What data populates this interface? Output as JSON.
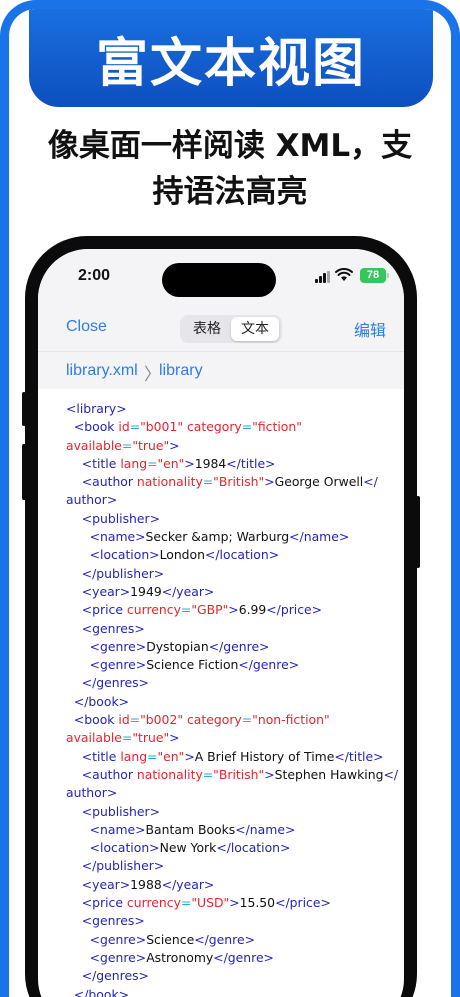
{
  "banner": {
    "title": "富文本视图"
  },
  "subtitle": {
    "line1": "像桌面一样阅读 XML，支",
    "line2": "持语法高亮"
  },
  "status": {
    "time": "2:00",
    "battery": "78"
  },
  "toolbar": {
    "close_label": "Close",
    "tab_table": "表格",
    "tab_text": "文本",
    "edit_label": "编辑"
  },
  "breadcrumb": {
    "file": "library.xml",
    "separator": "〉",
    "node": "library"
  },
  "icons": {
    "signal": "cellular-signal-icon",
    "wifi": "wifi-icon",
    "battery": "battery-icon"
  },
  "colors": {
    "accent": "#1a73e8",
    "tag": "#2424b8",
    "attr": "#e8232e",
    "battery": "#34c759"
  },
  "xml_lines": [
    [
      [
        "t",
        "<library>"
      ]
    ],
    [
      [
        "t",
        "  <book "
      ],
      [
        "a",
        "id"
      ],
      [
        "e",
        "="
      ],
      [
        "v",
        "\"b001\""
      ],
      [
        "t",
        " "
      ],
      [
        "a",
        "category"
      ],
      [
        "e",
        "="
      ],
      [
        "v",
        "\"fiction\""
      ]
    ],
    [
      [
        "a",
        "available"
      ],
      [
        "e",
        "="
      ],
      [
        "v",
        "\"true\""
      ],
      [
        "t",
        ">"
      ]
    ],
    [
      [
        "t",
        "    <title "
      ],
      [
        "a",
        "lang"
      ],
      [
        "e",
        "="
      ],
      [
        "v",
        "\"en\""
      ],
      [
        "t",
        ">"
      ],
      [
        "x",
        "1984"
      ],
      [
        "t",
        "</title>"
      ]
    ],
    [
      [
        "t",
        "    <author "
      ],
      [
        "a",
        "nationality"
      ],
      [
        "e",
        "="
      ],
      [
        "v",
        "\"British\""
      ],
      [
        "t",
        ">"
      ],
      [
        "x",
        "George Orwell"
      ],
      [
        "t",
        "</"
      ]
    ],
    [
      [
        "t",
        "author>"
      ]
    ],
    [
      [
        "t",
        "    <publisher>"
      ]
    ],
    [
      [
        "t",
        "      <name>"
      ],
      [
        "x",
        "Secker "
      ],
      [
        "n",
        "&amp;"
      ],
      [
        "x",
        " Warburg"
      ],
      [
        "t",
        "</name>"
      ]
    ],
    [
      [
        "t",
        "      <location>"
      ],
      [
        "x",
        "London"
      ],
      [
        "t",
        "</location>"
      ]
    ],
    [
      [
        "t",
        "    </publisher>"
      ]
    ],
    [
      [
        "t",
        "    <year>"
      ],
      [
        "x",
        "1949"
      ],
      [
        "t",
        "</year>"
      ]
    ],
    [
      [
        "t",
        "    <price "
      ],
      [
        "a",
        "currency"
      ],
      [
        "e",
        "="
      ],
      [
        "v",
        "\"GBP\""
      ],
      [
        "t",
        ">"
      ],
      [
        "x",
        "6.99"
      ],
      [
        "t",
        "</price>"
      ]
    ],
    [
      [
        "t",
        "    <genres>"
      ]
    ],
    [
      [
        "t",
        "      <genre>"
      ],
      [
        "x",
        "Dystopian"
      ],
      [
        "t",
        "</genre>"
      ]
    ],
    [
      [
        "t",
        "      <genre>"
      ],
      [
        "x",
        "Science Fiction"
      ],
      [
        "t",
        "</genre>"
      ]
    ],
    [
      [
        "t",
        "    </genres>"
      ]
    ],
    [
      [
        "t",
        "  </book>"
      ]
    ],
    [
      [
        "t",
        "  <book "
      ],
      [
        "a",
        "id"
      ],
      [
        "e",
        "="
      ],
      [
        "v",
        "\"b002\""
      ],
      [
        "t",
        " "
      ],
      [
        "a",
        "category"
      ],
      [
        "e",
        "="
      ],
      [
        "v",
        "\"non-fiction\""
      ]
    ],
    [
      [
        "a",
        "available"
      ],
      [
        "e",
        "="
      ],
      [
        "v",
        "\"true\""
      ],
      [
        "t",
        ">"
      ]
    ],
    [
      [
        "t",
        "    <title "
      ],
      [
        "a",
        "lang"
      ],
      [
        "e",
        "="
      ],
      [
        "v",
        "\"en\""
      ],
      [
        "t",
        ">"
      ],
      [
        "x",
        "A Brief History of Time"
      ],
      [
        "t",
        "</title>"
      ]
    ],
    [
      [
        "t",
        "    <author "
      ],
      [
        "a",
        "nationality"
      ],
      [
        "e",
        "="
      ],
      [
        "v",
        "\"British\""
      ],
      [
        "t",
        ">"
      ],
      [
        "x",
        "Stephen Hawking"
      ],
      [
        "t",
        "</"
      ]
    ],
    [
      [
        "t",
        "author>"
      ]
    ],
    [
      [
        "t",
        "    <publisher>"
      ]
    ],
    [
      [
        "t",
        "      <name>"
      ],
      [
        "x",
        "Bantam Books"
      ],
      [
        "t",
        "</name>"
      ]
    ],
    [
      [
        "t",
        "      <location>"
      ],
      [
        "x",
        "New York"
      ],
      [
        "t",
        "</location>"
      ]
    ],
    [
      [
        "t",
        "    </publisher>"
      ]
    ],
    [
      [
        "t",
        "    <year>"
      ],
      [
        "x",
        "1988"
      ],
      [
        "t",
        "</year>"
      ]
    ],
    [
      [
        "t",
        "    <price "
      ],
      [
        "a",
        "currency"
      ],
      [
        "e",
        "="
      ],
      [
        "v",
        "\"USD\""
      ],
      [
        "t",
        ">"
      ],
      [
        "x",
        "15.50"
      ],
      [
        "t",
        "</price>"
      ]
    ],
    [
      [
        "t",
        "    <genres>"
      ]
    ],
    [
      [
        "t",
        "      <genre>"
      ],
      [
        "x",
        "Science"
      ],
      [
        "t",
        "</genre>"
      ]
    ],
    [
      [
        "t",
        "      <genre>"
      ],
      [
        "x",
        "Astronomy"
      ],
      [
        "t",
        "</genre>"
      ]
    ],
    [
      [
        "t",
        "    </genres>"
      ]
    ],
    [
      [
        "t",
        "  </book>"
      ]
    ]
  ]
}
